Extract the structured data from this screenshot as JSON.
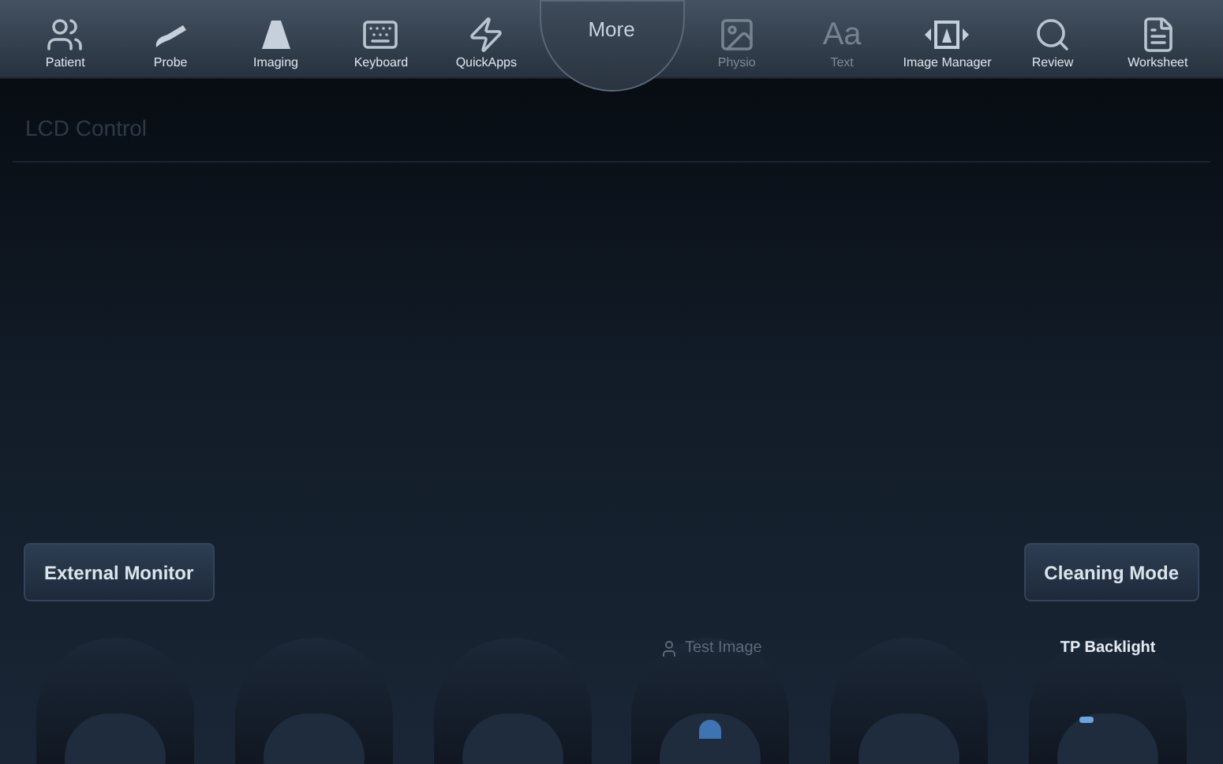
{
  "toolbar": [
    {
      "label": "Patient",
      "kind": "tool",
      "disabled": false
    },
    {
      "label": "Probe",
      "kind": "tool",
      "disabled": false
    },
    {
      "label": "Imaging",
      "kind": "tool",
      "disabled": false
    },
    {
      "label": "Keyboard",
      "kind": "tool",
      "disabled": false
    },
    {
      "label": "QuickApps",
      "kind": "tool",
      "disabled": false
    },
    {
      "label": "More",
      "kind": "more"
    },
    {
      "label": "Physio",
      "kind": "tool",
      "disabled": true
    },
    {
      "label": "Text",
      "kind": "tool",
      "disabled": true,
      "glyph": "Aa"
    },
    {
      "label": "Image Manager",
      "kind": "tool",
      "disabled": false
    },
    {
      "label": "Review",
      "kind": "tool",
      "disabled": false
    },
    {
      "label": "Worksheet",
      "kind": "tool",
      "disabled": false
    }
  ],
  "page_title": "LCD Control",
  "buttons": [
    "External Monitor",
    "Cleaning Mode"
  ],
  "knobs": [
    {
      "kind": "empty"
    },
    {
      "kind": "empty"
    },
    {
      "kind": "empty"
    },
    {
      "kind": "dot",
      "label": "Test Image",
      "disabled": true
    },
    {
      "kind": "empty"
    },
    {
      "kind": "bar",
      "label": "TP Backlight",
      "disabled": false
    }
  ]
}
